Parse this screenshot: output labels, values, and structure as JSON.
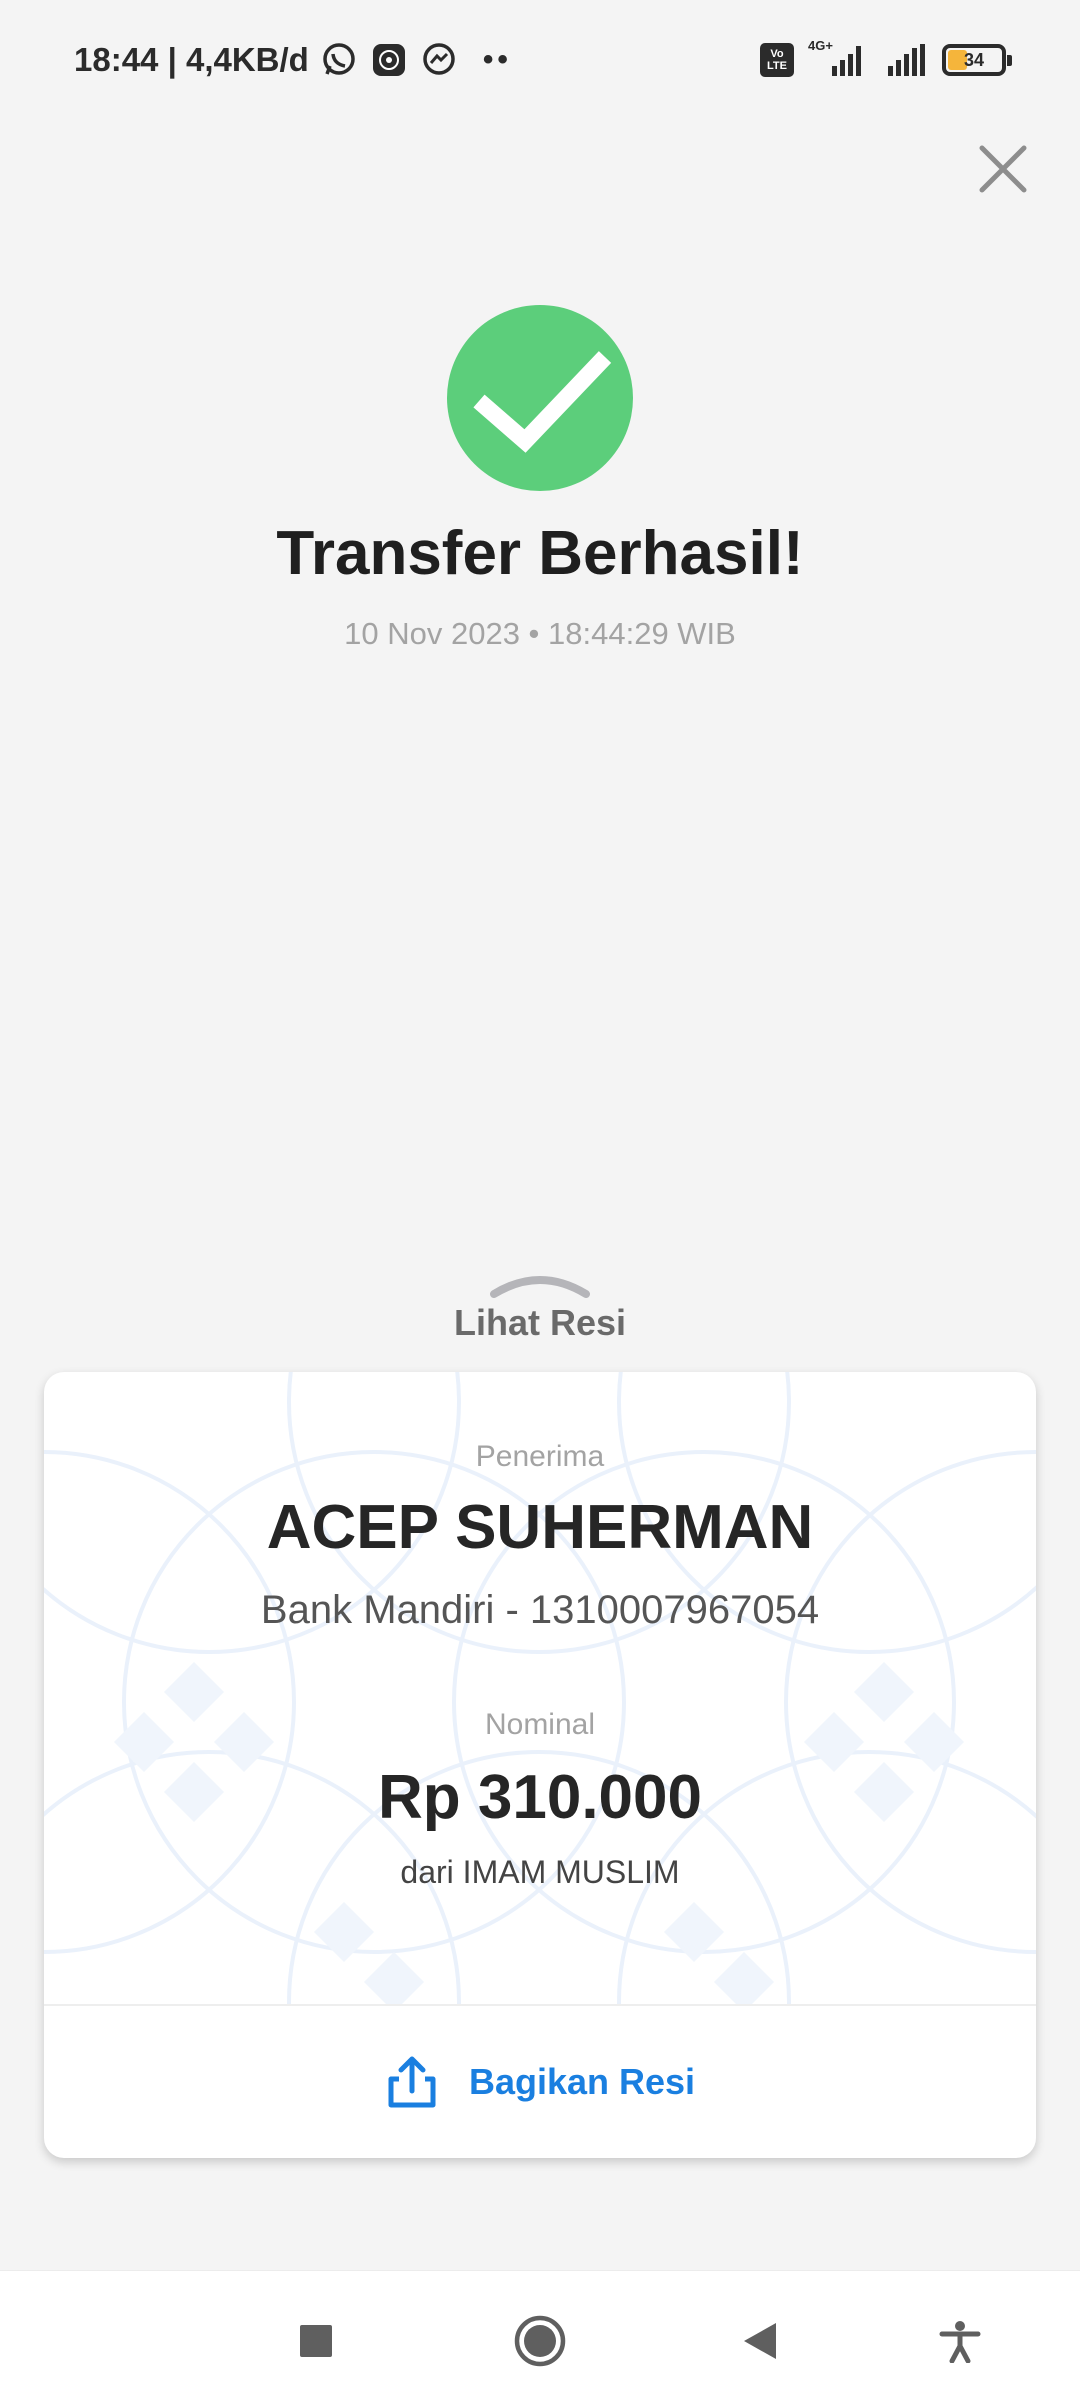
{
  "status_bar": {
    "time_speed": "18:44 | 4,4KB/d",
    "dots": "••",
    "volte_top": "Vo",
    "volte_bottom": "LTE",
    "network": "4G+",
    "battery_level": "34",
    "battery_fraction": 0.34,
    "icons": [
      "whatsapp-icon",
      "app-icon",
      "messenger-icon"
    ]
  },
  "header": {
    "close_icon": "close-icon"
  },
  "success": {
    "icon": "check-circle-icon",
    "icon_color": "#5cce7b",
    "title": "Transfer Berhasil!",
    "timestamp": "10 Nov 2023 • 18:44:29 WIB"
  },
  "receipt": {
    "toggle_label": "Lihat Resi",
    "recipient_label": "Penerima",
    "recipient_name": "ACEP SUHERMAN",
    "recipient_bank": "Bank Mandiri - 1310007967054",
    "amount_label": "Nominal",
    "amount": "Rp 310.000",
    "sender": "dari IMAM MUSLIM",
    "share_label": "Bagikan Resi",
    "accent_color": "#1a7fe0"
  },
  "nav": {
    "items": [
      "recents-icon",
      "home-icon",
      "back-icon",
      "accessibility-icon"
    ]
  }
}
